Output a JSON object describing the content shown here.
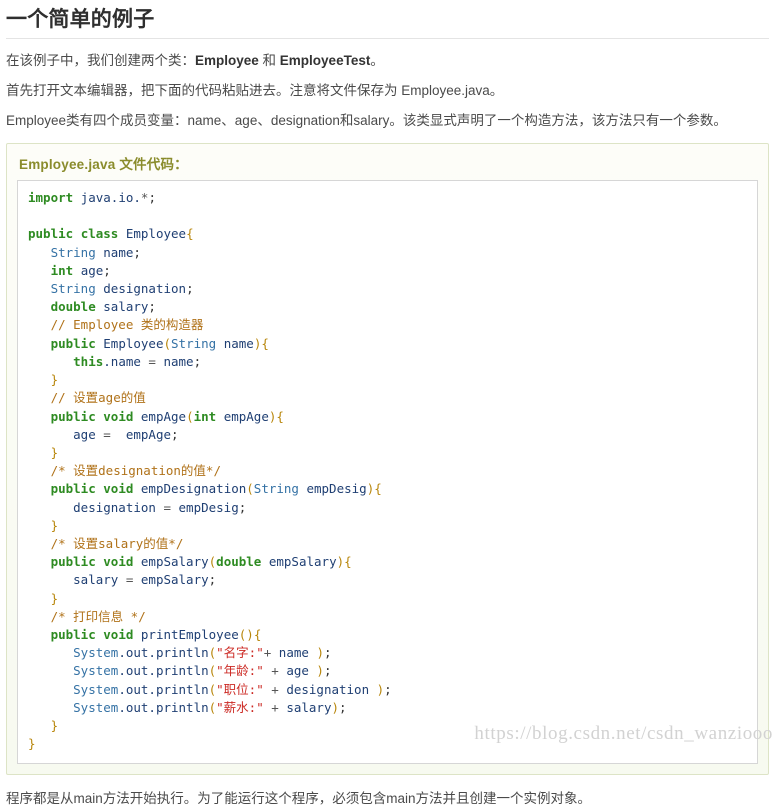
{
  "page_title": "一个简单的例子",
  "paragraphs": [
    {
      "id": "intro",
      "segments": [
        {
          "text": "在该例子中，我们创建两个类：",
          "bold": false
        },
        {
          "text": "Employee",
          "bold": true
        },
        {
          "text": " 和 ",
          "bold": false
        },
        {
          "text": "EmployeeTest",
          "bold": true
        },
        {
          "text": "。",
          "bold": false
        }
      ]
    },
    {
      "id": "editor-instruction",
      "segments": [
        {
          "text": "首先打开文本编辑器，把下面的代码粘贴进去。注意将文件保存为 Employee.java。",
          "bold": false
        }
      ]
    },
    {
      "id": "members-description",
      "segments": [
        {
          "text": "Employee类有四个成员变量：name、age、designation和salary。该类显式声明了一个构造方法，该方法只有一个参数。",
          "bold": false
        }
      ]
    }
  ],
  "code_block": {
    "title": "Employee.java 文件代码：",
    "language": "java",
    "lines": [
      [
        {
          "t": "import",
          "c": "k"
        },
        {
          "t": " ",
          "c": "plain"
        },
        {
          "t": "java.io.",
          "c": "id"
        },
        {
          "t": "*",
          "c": "op"
        },
        {
          "t": ";",
          "c": "plain"
        }
      ],
      [],
      [
        {
          "t": "public",
          "c": "k"
        },
        {
          "t": " ",
          "c": "plain"
        },
        {
          "t": "class",
          "c": "k"
        },
        {
          "t": " ",
          "c": "plain"
        },
        {
          "t": "Employee",
          "c": "id"
        },
        {
          "t": "{",
          "c": "p"
        }
      ],
      [
        {
          "t": "   ",
          "c": "plain"
        },
        {
          "t": "String",
          "c": "t"
        },
        {
          "t": " ",
          "c": "plain"
        },
        {
          "t": "name",
          "c": "id"
        },
        {
          "t": ";",
          "c": "plain"
        }
      ],
      [
        {
          "t": "   ",
          "c": "plain"
        },
        {
          "t": "int",
          "c": "k"
        },
        {
          "t": " ",
          "c": "plain"
        },
        {
          "t": "age",
          "c": "id"
        },
        {
          "t": ";",
          "c": "plain"
        }
      ],
      [
        {
          "t": "   ",
          "c": "plain"
        },
        {
          "t": "String",
          "c": "t"
        },
        {
          "t": " ",
          "c": "plain"
        },
        {
          "t": "designation",
          "c": "id"
        },
        {
          "t": ";",
          "c": "plain"
        }
      ],
      [
        {
          "t": "   ",
          "c": "plain"
        },
        {
          "t": "double",
          "c": "k"
        },
        {
          "t": " ",
          "c": "plain"
        },
        {
          "t": "salary",
          "c": "id"
        },
        {
          "t": ";",
          "c": "plain"
        }
      ],
      [
        {
          "t": "   ",
          "c": "plain"
        },
        {
          "t": "// Employee 类的构造器",
          "c": "cm"
        }
      ],
      [
        {
          "t": "   ",
          "c": "plain"
        },
        {
          "t": "public",
          "c": "k"
        },
        {
          "t": " ",
          "c": "plain"
        },
        {
          "t": "Employee",
          "c": "id"
        },
        {
          "t": "(",
          "c": "p"
        },
        {
          "t": "String",
          "c": "t"
        },
        {
          "t": " ",
          "c": "plain"
        },
        {
          "t": "name",
          "c": "id"
        },
        {
          "t": ")",
          "c": "p"
        },
        {
          "t": "{",
          "c": "p"
        }
      ],
      [
        {
          "t": "      ",
          "c": "plain"
        },
        {
          "t": "this",
          "c": "k"
        },
        {
          "t": ".name",
          "c": "id"
        },
        {
          "t": " = ",
          "c": "op"
        },
        {
          "t": "name",
          "c": "id"
        },
        {
          "t": ";",
          "c": "plain"
        }
      ],
      [
        {
          "t": "   ",
          "c": "plain"
        },
        {
          "t": "}",
          "c": "p"
        }
      ],
      [
        {
          "t": "   ",
          "c": "plain"
        },
        {
          "t": "// 设置age的值",
          "c": "cm"
        }
      ],
      [
        {
          "t": "   ",
          "c": "plain"
        },
        {
          "t": "public",
          "c": "k"
        },
        {
          "t": " ",
          "c": "plain"
        },
        {
          "t": "void",
          "c": "k"
        },
        {
          "t": " ",
          "c": "plain"
        },
        {
          "t": "empAge",
          "c": "id"
        },
        {
          "t": "(",
          "c": "p"
        },
        {
          "t": "int",
          "c": "k"
        },
        {
          "t": " ",
          "c": "plain"
        },
        {
          "t": "empAge",
          "c": "id"
        },
        {
          "t": ")",
          "c": "p"
        },
        {
          "t": "{",
          "c": "p"
        }
      ],
      [
        {
          "t": "      ",
          "c": "plain"
        },
        {
          "t": "age",
          "c": "id"
        },
        {
          "t": " =  ",
          "c": "op"
        },
        {
          "t": "empAge",
          "c": "id"
        },
        {
          "t": ";",
          "c": "plain"
        }
      ],
      [
        {
          "t": "   ",
          "c": "plain"
        },
        {
          "t": "}",
          "c": "p"
        }
      ],
      [
        {
          "t": "   ",
          "c": "plain"
        },
        {
          "t": "/* 设置designation的值*/",
          "c": "cm"
        }
      ],
      [
        {
          "t": "   ",
          "c": "plain"
        },
        {
          "t": "public",
          "c": "k"
        },
        {
          "t": " ",
          "c": "plain"
        },
        {
          "t": "void",
          "c": "k"
        },
        {
          "t": " ",
          "c": "plain"
        },
        {
          "t": "empDesignation",
          "c": "id"
        },
        {
          "t": "(",
          "c": "p"
        },
        {
          "t": "String",
          "c": "t"
        },
        {
          "t": " ",
          "c": "plain"
        },
        {
          "t": "empDesig",
          "c": "id"
        },
        {
          "t": ")",
          "c": "p"
        },
        {
          "t": "{",
          "c": "p"
        }
      ],
      [
        {
          "t": "      ",
          "c": "plain"
        },
        {
          "t": "designation",
          "c": "id"
        },
        {
          "t": " = ",
          "c": "op"
        },
        {
          "t": "empDesig",
          "c": "id"
        },
        {
          "t": ";",
          "c": "plain"
        }
      ],
      [
        {
          "t": "   ",
          "c": "plain"
        },
        {
          "t": "}",
          "c": "p"
        }
      ],
      [
        {
          "t": "   ",
          "c": "plain"
        },
        {
          "t": "/* 设置salary的值*/",
          "c": "cm"
        }
      ],
      [
        {
          "t": "   ",
          "c": "plain"
        },
        {
          "t": "public",
          "c": "k"
        },
        {
          "t": " ",
          "c": "plain"
        },
        {
          "t": "void",
          "c": "k"
        },
        {
          "t": " ",
          "c": "plain"
        },
        {
          "t": "empSalary",
          "c": "id"
        },
        {
          "t": "(",
          "c": "p"
        },
        {
          "t": "double",
          "c": "k"
        },
        {
          "t": " ",
          "c": "plain"
        },
        {
          "t": "empSalary",
          "c": "id"
        },
        {
          "t": ")",
          "c": "p"
        },
        {
          "t": "{",
          "c": "p"
        }
      ],
      [
        {
          "t": "      ",
          "c": "plain"
        },
        {
          "t": "salary",
          "c": "id"
        },
        {
          "t": " = ",
          "c": "op"
        },
        {
          "t": "empSalary",
          "c": "id"
        },
        {
          "t": ";",
          "c": "plain"
        }
      ],
      [
        {
          "t": "   ",
          "c": "plain"
        },
        {
          "t": "}",
          "c": "p"
        }
      ],
      [
        {
          "t": "   ",
          "c": "plain"
        },
        {
          "t": "/* 打印信息 */",
          "c": "cm"
        }
      ],
      [
        {
          "t": "   ",
          "c": "plain"
        },
        {
          "t": "public",
          "c": "k"
        },
        {
          "t": " ",
          "c": "plain"
        },
        {
          "t": "void",
          "c": "k"
        },
        {
          "t": " ",
          "c": "plain"
        },
        {
          "t": "printEmployee",
          "c": "id"
        },
        {
          "t": "(",
          "c": "p"
        },
        {
          "t": ")",
          "c": "p"
        },
        {
          "t": "{",
          "c": "p"
        }
      ],
      [
        {
          "t": "      ",
          "c": "plain"
        },
        {
          "t": "System",
          "c": "t"
        },
        {
          "t": ".out.println",
          "c": "id"
        },
        {
          "t": "(",
          "c": "p"
        },
        {
          "t": "\"名字:\"",
          "c": "str"
        },
        {
          "t": "+ ",
          "c": "op"
        },
        {
          "t": "name",
          "c": "id"
        },
        {
          "t": " ",
          "c": "plain"
        },
        {
          "t": ")",
          "c": "p"
        },
        {
          "t": ";",
          "c": "plain"
        }
      ],
      [
        {
          "t": "      ",
          "c": "plain"
        },
        {
          "t": "System",
          "c": "t"
        },
        {
          "t": ".out.println",
          "c": "id"
        },
        {
          "t": "(",
          "c": "p"
        },
        {
          "t": "\"年龄:\"",
          "c": "str"
        },
        {
          "t": " + ",
          "c": "op"
        },
        {
          "t": "age",
          "c": "id"
        },
        {
          "t": " ",
          "c": "plain"
        },
        {
          "t": ")",
          "c": "p"
        },
        {
          "t": ";",
          "c": "plain"
        }
      ],
      [
        {
          "t": "      ",
          "c": "plain"
        },
        {
          "t": "System",
          "c": "t"
        },
        {
          "t": ".out.println",
          "c": "id"
        },
        {
          "t": "(",
          "c": "p"
        },
        {
          "t": "\"职位:\"",
          "c": "str"
        },
        {
          "t": " + ",
          "c": "op"
        },
        {
          "t": "designation",
          "c": "id"
        },
        {
          "t": " ",
          "c": "plain"
        },
        {
          "t": ")",
          "c": "p"
        },
        {
          "t": ";",
          "c": "plain"
        }
      ],
      [
        {
          "t": "      ",
          "c": "plain"
        },
        {
          "t": "System",
          "c": "t"
        },
        {
          "t": ".out.println",
          "c": "id"
        },
        {
          "t": "(",
          "c": "p"
        },
        {
          "t": "\"薪水:\"",
          "c": "str"
        },
        {
          "t": " + ",
          "c": "op"
        },
        {
          "t": "salary",
          "c": "id"
        },
        {
          "t": ")",
          "c": "p"
        },
        {
          "t": ";",
          "c": "plain"
        }
      ],
      [
        {
          "t": "   ",
          "c": "plain"
        },
        {
          "t": "}",
          "c": "p"
        }
      ],
      [
        {
          "t": "}",
          "c": "p"
        }
      ]
    ]
  },
  "footer_note": "程序都是从main方法开始执行。为了能运行这个程序，必须包含main方法并且创建一个实例对象。",
  "watermark": "https://blog.csdn.net/csdn_wanziooo",
  "colors": {
    "keyword": "#2e8b22",
    "type": "#3572a5",
    "identifier": "#1f3f73",
    "comment": "#b07219",
    "string": "#cc2a24",
    "punctuation": "#b8860b",
    "box_border": "#dde4c6",
    "box_background": "#fbfdf5",
    "code_title": "#8a8c2c",
    "body_text": "#4a4a4a"
  }
}
